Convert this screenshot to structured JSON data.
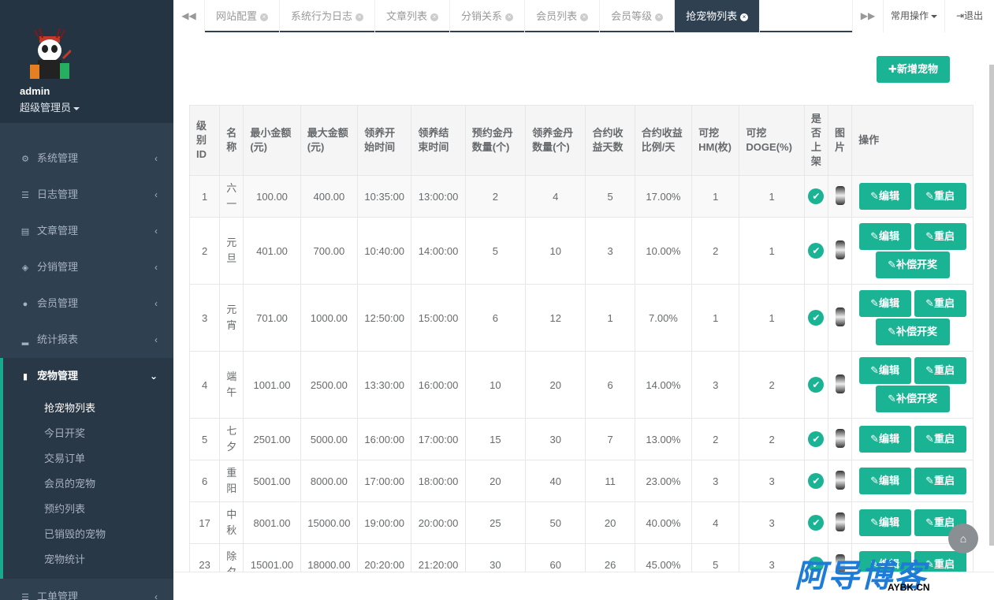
{
  "user": {
    "name": "admin",
    "role": "超级管理员"
  },
  "menu": [
    {
      "label": "系统管理",
      "icon": "gear-icon"
    },
    {
      "label": "日志管理",
      "icon": "list-icon"
    },
    {
      "label": "文章管理",
      "icon": "archive-icon"
    },
    {
      "label": "分销管理",
      "icon": "cubes-icon"
    },
    {
      "label": "会员管理",
      "icon": "user-icon"
    },
    {
      "label": "统计报表",
      "icon": "signal-icon"
    },
    {
      "label": "宠物管理",
      "icon": "book-icon"
    },
    {
      "label": "工单管理",
      "icon": "list-icon"
    }
  ],
  "submenu": [
    "抢宠物列表",
    "今日开奖",
    "交易订单",
    "会员的宠物",
    "预约列表",
    "已销毁的宠物",
    "宠物统计"
  ],
  "tabs": [
    "网站配置",
    "系统行为日志",
    "文章列表",
    "分销关系",
    "会员列表",
    "会员等级",
    "抢宠物列表"
  ],
  "topbar": {
    "prev": "◀◀",
    "next": "▶▶",
    "ops": "常用操作",
    "logout": "退出"
  },
  "add_label": "新增宠物",
  "headers": [
    "级别ID",
    "名称",
    "最小金额(元)",
    "最大金额(元)",
    "领养开始时间",
    "领养结束时间",
    "预约金丹数量(个)",
    "领养金丹数量(个)",
    "合约收益天数",
    "合约收益比例/天",
    "可挖HM(枚)",
    "可挖DOGE(%)",
    "是否上架",
    "图片",
    "操作"
  ],
  "buttons": {
    "edit": "编辑",
    "restart": "重启",
    "compensate": "补偿开奖"
  },
  "rows": [
    {
      "id": "1",
      "name": "六一",
      "min": "100.00",
      "max": "400.00",
      "start": "10:35:00",
      "end": "13:00:00",
      "reserve": "2",
      "adopt": "4",
      "days": "5",
      "rate": "17.00%",
      "hm": "1",
      "doge": "1",
      "comp": false
    },
    {
      "id": "2",
      "name": "元旦",
      "min": "401.00",
      "max": "700.00",
      "start": "10:40:00",
      "end": "14:00:00",
      "reserve": "5",
      "adopt": "10",
      "days": "3",
      "rate": "10.00%",
      "hm": "2",
      "doge": "1",
      "comp": true
    },
    {
      "id": "3",
      "name": "元宵",
      "min": "701.00",
      "max": "1000.00",
      "start": "12:50:00",
      "end": "15:00:00",
      "reserve": "6",
      "adopt": "12",
      "days": "1",
      "rate": "7.00%",
      "hm": "1",
      "doge": "1",
      "comp": true
    },
    {
      "id": "4",
      "name": "端午",
      "min": "1001.00",
      "max": "2500.00",
      "start": "13:30:00",
      "end": "16:00:00",
      "reserve": "10",
      "adopt": "20",
      "days": "6",
      "rate": "14.00%",
      "hm": "3",
      "doge": "2",
      "comp": true
    },
    {
      "id": "5",
      "name": "七夕",
      "min": "2501.00",
      "max": "5000.00",
      "start": "16:00:00",
      "end": "17:00:00",
      "reserve": "15",
      "adopt": "30",
      "days": "7",
      "rate": "13.00%",
      "hm": "2",
      "doge": "2",
      "comp": false
    },
    {
      "id": "6",
      "name": "重阳",
      "min": "5001.00",
      "max": "8000.00",
      "start": "17:00:00",
      "end": "18:00:00",
      "reserve": "20",
      "adopt": "40",
      "days": "11",
      "rate": "23.00%",
      "hm": "3",
      "doge": "3",
      "comp": false
    },
    {
      "id": "17",
      "name": "中秋",
      "min": "8001.00",
      "max": "15000.00",
      "start": "19:00:00",
      "end": "20:00:00",
      "reserve": "25",
      "adopt": "50",
      "days": "20",
      "rate": "40.00%",
      "hm": "4",
      "doge": "3",
      "comp": false
    },
    {
      "id": "23",
      "name": "除夕",
      "min": "15001.00",
      "max": "18000.00",
      "start": "20:20:00",
      "end": "21:20:00",
      "reserve": "30",
      "adopt": "60",
      "days": "26",
      "rate": "45.00%",
      "hm": "5",
      "doge": "3",
      "comp": false
    }
  ],
  "watermark": {
    "big": "阿导博客",
    "small": "AYBK.CN"
  },
  "colors": {
    "sidebar": "#2f4050",
    "accent": "#1ab394"
  }
}
